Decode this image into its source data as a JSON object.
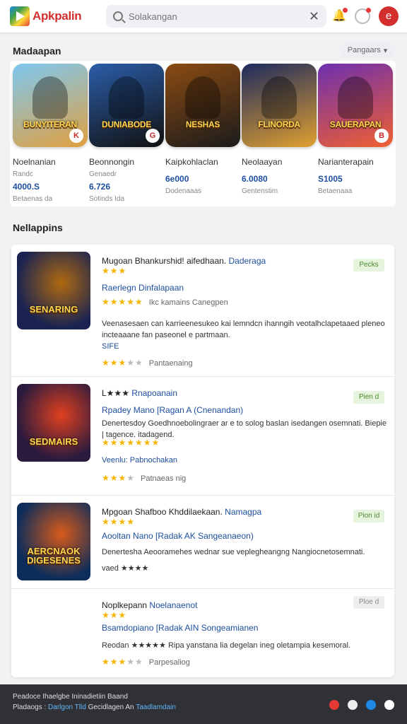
{
  "header": {
    "logo_text": "Apkpalin",
    "search_placeholder": "Solakangan",
    "clear_glyph": "✕",
    "bell_glyph": "🔔",
    "avatar_glyph": "e"
  },
  "featured": {
    "title": "Madaapan",
    "sort_label": "Pangaars",
    "items": [
      {
        "art": "BUNYITERAN",
        "name": "Noelnanian",
        "sub": "Randc",
        "price": "4000.S",
        "meta": "Betaenas da",
        "colors": [
          "#7ec8f0",
          "#e0a040"
        ],
        "badge": "K"
      },
      {
        "art": "DUNIABODE",
        "name": "Beonnongin",
        "sub": "Genaedr",
        "price": "6.726",
        "meta": "Sotinds Ida",
        "colors": [
          "#2b5da8",
          "#111"
        ],
        "badge": "G"
      },
      {
        "art": "NESHAS",
        "name": "Kaipkohlaclan",
        "sub": "",
        "price": "6e000",
        "meta": "Dodenaaas",
        "colors": [
          "#8a4b12",
          "#1b1b1b"
        ],
        "badge": ""
      },
      {
        "art": "FLINORDA",
        "name": "Neolaayan",
        "sub": "",
        "price": "6.0080",
        "meta": "Gentenstim",
        "colors": [
          "#1d2a5e",
          "#e0a030"
        ],
        "badge": ""
      },
      {
        "art": "SAUERAPAN",
        "name": "Narianterapain",
        "sub": "",
        "price": "S1005",
        "meta": "Betaenaaa",
        "colors": [
          "#6d2fb0",
          "#f06030"
        ],
        "badge": "B"
      }
    ]
  },
  "list": {
    "title": "Nellappins",
    "rows": [
      {
        "art": "SENARING",
        "colors": [
          "#1a2350",
          "#b06a10"
        ],
        "title_pre": "Mugoan Bhankurshid! aifedhaan.",
        "title_hl": "Daderaga",
        "tag": "Pecks",
        "stars_top": "★★★",
        "sub": "Raerlegn Dinfalapaan",
        "stars2": "★★★★★",
        "stars2_label": "Ikc kamains Canegpen",
        "desc": "Veenasesaen can karrieenesukeo kai lemndcn ihanngih veotalhclapetaaed pleneo incteaaane fan paseonel e partmaan.",
        "link": "SIFE",
        "stars3": "★★★",
        "stars3_off": "★★",
        "stars3_label": "Pantaenaing"
      },
      {
        "art": "SEDMAIRS",
        "colors": [
          "#2a1a3d",
          "#e04020"
        ],
        "title_pre": "L★★★",
        "title_hl": "Rnapoanain",
        "tag": "Pien d",
        "stars_top": "",
        "sub": "Rpadey Mano [Ragan A (Cnenandan)",
        "stars2": "★★★★★★★",
        "stars2_label": "",
        "desc": "Denertesdoy Goedhnoebolingraer ar e to solog baslan isedangen osemnati. Biepie | tagence. itadagend.",
        "link": "Veenlu: Pabnochakan",
        "stars3": "★★★",
        "stars3_off": "★",
        "stars3_label": "Patnaeas nig"
      },
      {
        "art": "AERCNAOK DIGESENES",
        "colors": [
          "#0d2d5a",
          "#d85a1a"
        ],
        "title_pre": "Mpgoan Shafboo Khddilaekaan.",
        "title_hl": "Namagpa",
        "tag": "Pion id",
        "stars_top": "★★★★",
        "sub": "Aooltan Nano [Radak AK Sangeanaeon)",
        "stars2": "",
        "stars2_label": "",
        "desc": "Denertesha Aeooramehes wednar sue veplegheangng Nangiocnetosemnati.",
        "link": "vaed ★★★★",
        "stars3": "",
        "stars3_off": "",
        "stars3_label": ""
      },
      {
        "art": "",
        "colors": [
          "#ffffff",
          "#ffffff"
        ],
        "title_pre": "Noplkepann",
        "title_hl": "Noelanaenot",
        "tag": "Ploe d",
        "stars_top": "★★★",
        "sub": "Bsamdopiano [Radak AIN Songeamianen",
        "stars2": "",
        "stars2_label": "",
        "desc": "Reodan ★★★★★ Ripa yanstana lia degelan ineg oletampia kesemoral.",
        "link": "",
        "stars3": "★★★",
        "stars3_off": "★★",
        "stars3_label": "Parpesaliog"
      }
    ]
  },
  "footer": {
    "line1": "Peadoce Ihaelgbe Ininadietiin Baand",
    "line2_a": "Pladaogs :",
    "line2_b": "Darlgon Tlld",
    "line2_c": "Gecidlagen An",
    "line2_d": "Taadlamdain"
  },
  "colors": {
    "accent": "#d32f2f",
    "link": "#1e4fa0",
    "star": "#f5b400",
    "tag_bg": "#e6f4dd"
  }
}
